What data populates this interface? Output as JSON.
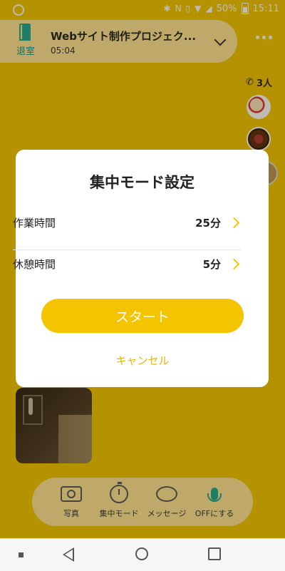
{
  "status_bar": {
    "battery": "50%",
    "time": "15:11"
  },
  "header": {
    "exit_label": "退室",
    "title": "Webサイト制作プロジェク...",
    "elapsed": "05:04"
  },
  "participants": {
    "count_label": "3人"
  },
  "modal": {
    "title": "集中モード設定",
    "rows": [
      {
        "label": "作業時間",
        "value": "25分"
      },
      {
        "label": "休憩時間",
        "value": "5分"
      }
    ],
    "start_label": "スタート",
    "cancel_label": "キャンセル",
    "accent_color": "#f5c400"
  },
  "toolbar": {
    "items": [
      {
        "label": "写真",
        "icon": "camera-icon"
      },
      {
        "label": "集中モード",
        "icon": "stopwatch-icon"
      },
      {
        "label": "メッセージ",
        "icon": "chat-bubble-icon"
      },
      {
        "label": "OFFにする",
        "icon": "microphone-icon"
      }
    ]
  },
  "colors": {
    "background": "#f2c500",
    "header_bg": "#ffe59a",
    "accent_teal": "#1ea896"
  }
}
